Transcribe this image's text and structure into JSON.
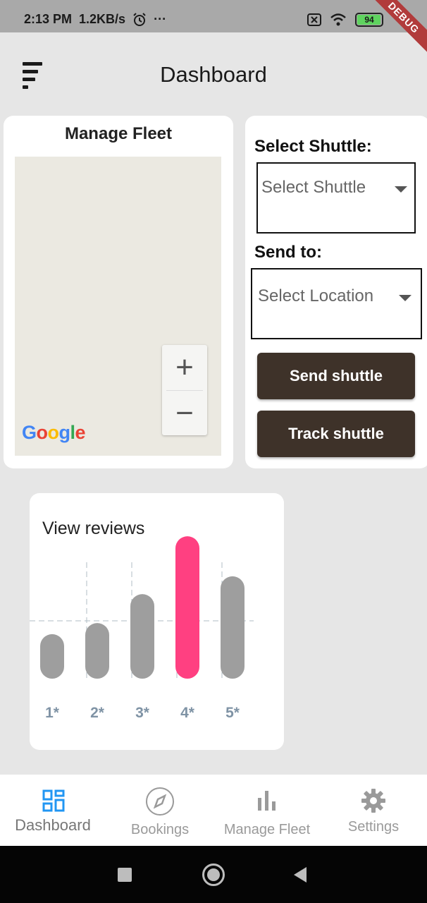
{
  "status_bar": {
    "time": "2:13 PM",
    "speed": "1.2KB/s",
    "more": "···",
    "battery": "94",
    "debug_label": "DEBUG"
  },
  "app_bar": {
    "title": "Dashboard"
  },
  "fleet": {
    "title": "Manage Fleet",
    "zoom_in": "+",
    "zoom_out": "−",
    "map_logo": "Google"
  },
  "shuttle_panel": {
    "select_shuttle_label": "Select Shuttle:",
    "select_shuttle_placeholder": "Select Shuttle",
    "send_to_label": "Send to:",
    "select_location_placeholder": "Select Location",
    "send_button": "Send shuttle",
    "track_button": "Track shuttle"
  },
  "reviews": {
    "title": "View reviews"
  },
  "chart_data": {
    "type": "bar",
    "categories": [
      "1*",
      "2*",
      "3*",
      "4*",
      "5*"
    ],
    "values": [
      2,
      2.5,
      3.8,
      6.4,
      4.6
    ],
    "ylim": [
      0,
      6.5
    ],
    "highlight_index": 3,
    "colors": {
      "bar": "#9e9e9e",
      "highlight": "#ff4081",
      "grid": "#b0bec5",
      "label": "#7f93a5"
    },
    "grid": true
  },
  "bottom_nav": {
    "items": [
      {
        "label": "Dashboard",
        "icon": "dashboard-icon",
        "active": true
      },
      {
        "label": "Bookings",
        "icon": "compass-icon",
        "active": false
      },
      {
        "label": "Manage Fleet",
        "icon": "bar-chart-icon",
        "active": false
      },
      {
        "label": "Settings",
        "icon": "gear-icon",
        "active": false
      }
    ],
    "active_color": "#2196f3"
  }
}
